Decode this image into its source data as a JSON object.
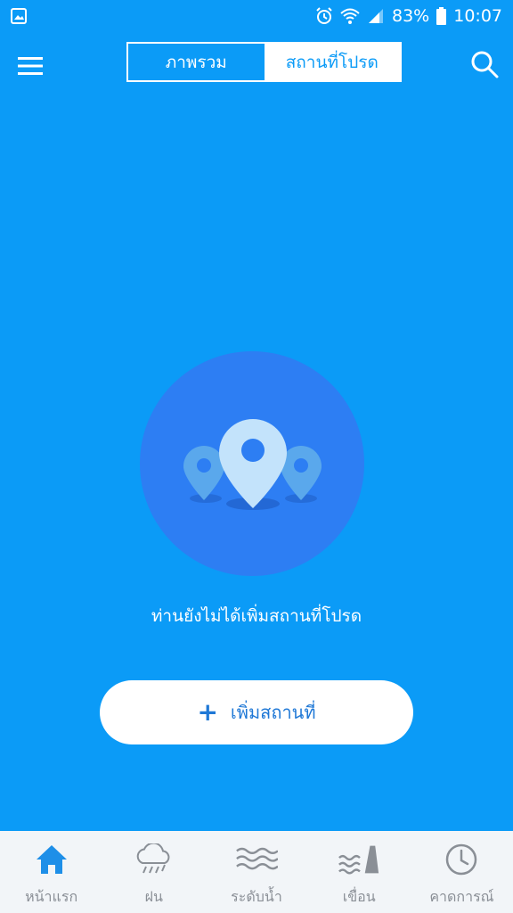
{
  "status_bar": {
    "battery": "83%",
    "time": "10:07"
  },
  "tabs": [
    {
      "label": "ภาพรวม",
      "active": false
    },
    {
      "label": "สถานที่โปรด",
      "active": true
    }
  ],
  "empty_state": {
    "message": "ท่านยังไม่ได้เพิ่มสถานที่โปรด"
  },
  "add_button": {
    "label": "เพิ่มสถานที่"
  },
  "bottom_nav": [
    {
      "label": "หน้าแรก",
      "icon": "home-icon",
      "active": true
    },
    {
      "label": "ฝน",
      "icon": "rain-cloud-icon",
      "active": false
    },
    {
      "label": "ระดับน้ำ",
      "icon": "water-level-icon",
      "active": false
    },
    {
      "label": "เขื่อน",
      "icon": "dam-icon",
      "active": false
    },
    {
      "label": "คาดการณ์",
      "icon": "clock-icon",
      "active": false
    }
  ],
  "colors": {
    "background": "#0b9bf7",
    "circle": "#2d7ef3",
    "nav_active": "#1e8fe8",
    "nav_inactive": "#8a8f96"
  }
}
